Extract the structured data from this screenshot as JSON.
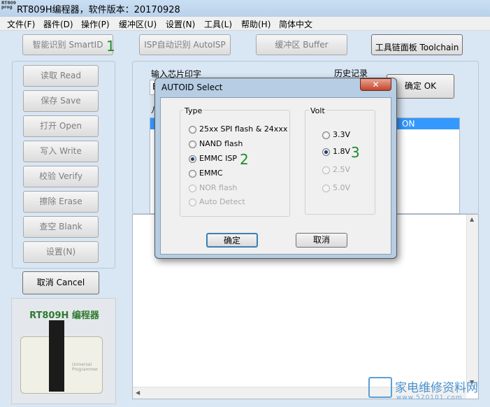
{
  "window": {
    "title": "RT809H编程器，软件版本：20170928",
    "logo_text": "RT809 prog"
  },
  "menu": [
    "文件(F)",
    "器件(D)",
    "操作(P)",
    "缓冲区(U)",
    "设置(N)",
    "工具(L)",
    "帮助(H)",
    "简体中文"
  ],
  "toolbar": {
    "smartid": "智能识别 SmartID",
    "autoisp": "ISP自动识别 AutoISP",
    "buffer": "缓冲区 Buffer",
    "toolchain": "工具链面板 Toolchain"
  },
  "left_buttons": [
    "读取 Read",
    "保存 Save",
    "打开 Open",
    "写入 Write",
    "校验 Verify",
    "擦除 Erase",
    "查空 Blank",
    "设置(N)"
  ],
  "cancel_button": "取消 Cancel",
  "product": {
    "name": "RT809H 编程器",
    "device_text": "Universal Programmer"
  },
  "chip_input": {
    "label": "输入芯片印字",
    "value": "E"
  },
  "history": {
    "label": "历史记录",
    "ok_button": "确定 OK",
    "selected_item": "ON",
    "row_label": "八"
  },
  "dialog": {
    "title": "AUTOID Select",
    "close": "✕",
    "type_label": "Type",
    "types": [
      {
        "label": "25xx SPI flash & 24xxx",
        "checked": false,
        "disabled": false
      },
      {
        "label": "NAND flash",
        "checked": false,
        "disabled": false
      },
      {
        "label": "EMMC ISP",
        "checked": true,
        "disabled": false
      },
      {
        "label": "EMMC",
        "checked": false,
        "disabled": false
      },
      {
        "label": "NOR flash",
        "checked": false,
        "disabled": true
      },
      {
        "label": "Auto Detect",
        "checked": false,
        "disabled": true
      }
    ],
    "volt_label": "Volt",
    "volts": [
      {
        "label": "3.3V",
        "checked": false,
        "disabled": false
      },
      {
        "label": "1.8V",
        "checked": true,
        "disabled": false
      },
      {
        "label": "2.5V",
        "checked": false,
        "disabled": true
      },
      {
        "label": "5.0V",
        "checked": false,
        "disabled": true
      }
    ],
    "ok": "确定",
    "cancel": "取消"
  },
  "annotations": [
    "1",
    "2",
    "3"
  ],
  "watermark": {
    "text": "家电维修资料网",
    "url": "www.520101.com"
  }
}
